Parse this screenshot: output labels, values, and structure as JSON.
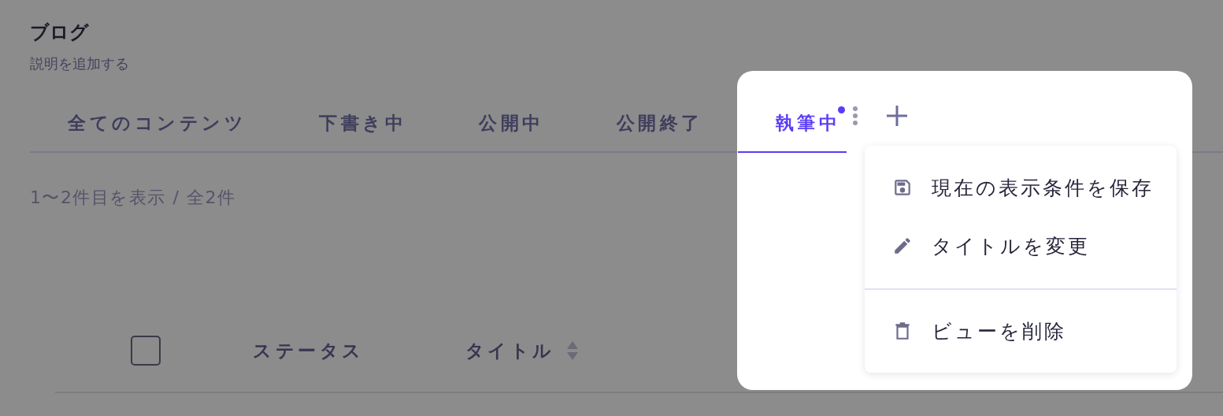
{
  "page": {
    "title": "ブログ",
    "description": "説明を追加する"
  },
  "tabs": [
    {
      "label": "全てのコンテンツ",
      "selected": false,
      "unsaved": false
    },
    {
      "label": "下書き中",
      "selected": false,
      "unsaved": false
    },
    {
      "label": "公開中",
      "selected": false,
      "unsaved": false
    },
    {
      "label": "公開終了",
      "selected": false,
      "unsaved": false
    },
    {
      "label": "執筆中",
      "selected": true,
      "unsaved": true
    }
  ],
  "count_text": "1〜2件目を表示 / 全2件",
  "table": {
    "select_all": {
      "checked": false
    },
    "columns": [
      {
        "label": "ステータス",
        "sortable": false
      },
      {
        "label": "タイトル",
        "sortable": true
      }
    ]
  },
  "menu": {
    "sections": [
      [
        {
          "kind": "save",
          "label": "現在の表示条件を保存"
        },
        {
          "kind": "rename",
          "label": "タイトルを変更"
        }
      ],
      [
        {
          "kind": "delete",
          "label": "ビューを削除"
        }
      ]
    ]
  }
}
